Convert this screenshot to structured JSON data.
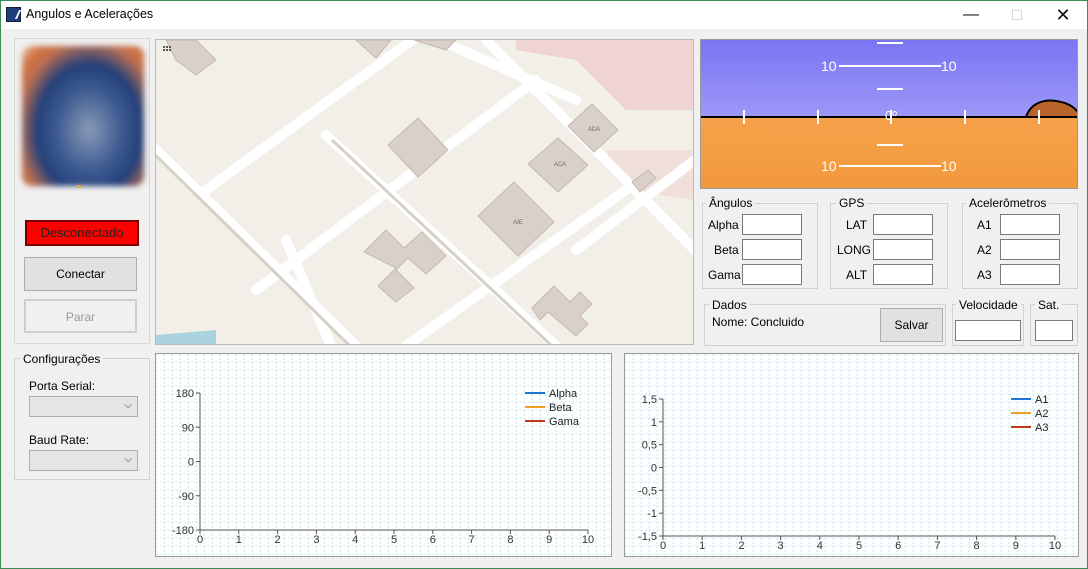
{
  "window": {
    "title": "Angulos e Acelerações",
    "minimize": "—",
    "maximize": "☐",
    "close": "✕"
  },
  "status": {
    "label": "Desconectado"
  },
  "buttons": {
    "connect": "Conectar",
    "stop": "Parar",
    "save": "Salvar"
  },
  "map": {
    "labels": [
      "ADA",
      "ACA",
      "AIE"
    ]
  },
  "horizon": {
    "pitch_labels": [
      "10",
      "10",
      "10",
      "10"
    ],
    "center_label": "0º",
    "sky_color": "#7c78f0",
    "ground_color": "#f4a048"
  },
  "angulos": {
    "title": "Ângulos",
    "alpha_label": "Alpha",
    "beta_label": "Beta",
    "gama_label": "Gama",
    "alpha": "",
    "beta": "",
    "gama": ""
  },
  "gps": {
    "title": "GPS",
    "lat_label": "LAT",
    "long_label": "LONG",
    "alt_label": "ALT",
    "lat": "",
    "long": "",
    "alt": ""
  },
  "acel": {
    "title": "Acelerômetros",
    "a1_label": "A1",
    "a2_label": "A2",
    "a3_label": "A3",
    "a1": "",
    "a2": "",
    "a3": ""
  },
  "dados": {
    "title": "Dados",
    "text": "Nome: Concluido"
  },
  "velocidade": {
    "title": "Velocidade",
    "value": ""
  },
  "sat": {
    "title": "Sat.",
    "value": ""
  },
  "config": {
    "title": "Configurações",
    "serial_label": "Porta Serial:",
    "serial_value": "",
    "baud_label": "Baud Rate:",
    "baud_value": ""
  },
  "chart_data": [
    {
      "type": "line",
      "title": "",
      "x_ticks": [
        "0",
        "1",
        "2",
        "3",
        "4",
        "5",
        "6",
        "7",
        "8",
        "9",
        "10"
      ],
      "y_ticks": [
        "180",
        "90",
        "0",
        "-90",
        "-180"
      ],
      "xlim": [
        0,
        10
      ],
      "ylim": [
        -180,
        180
      ],
      "grid": true,
      "legend_position": "top-right",
      "series": [
        {
          "name": "Alpha",
          "color": "#1f77d4",
          "values": []
        },
        {
          "name": "Beta",
          "color": "#f0a020",
          "values": []
        },
        {
          "name": "Gama",
          "color": "#c0381a",
          "values": []
        }
      ]
    },
    {
      "type": "line",
      "title": "",
      "x_ticks": [
        "0",
        "1",
        "2",
        "3",
        "4",
        "5",
        "6",
        "7",
        "8",
        "9",
        "10"
      ],
      "y_ticks": [
        "1,5",
        "1",
        "0,5",
        "0",
        "-0,5",
        "-1",
        "-1,5"
      ],
      "xlim": [
        0,
        10
      ],
      "ylim": [
        -1.5,
        1.5
      ],
      "grid": true,
      "legend_position": "top-right",
      "series": [
        {
          "name": "A1",
          "color": "#1f77d4",
          "values": []
        },
        {
          "name": "A2",
          "color": "#f0a020",
          "values": []
        },
        {
          "name": "A3",
          "color": "#c0381a",
          "values": []
        }
      ]
    }
  ]
}
